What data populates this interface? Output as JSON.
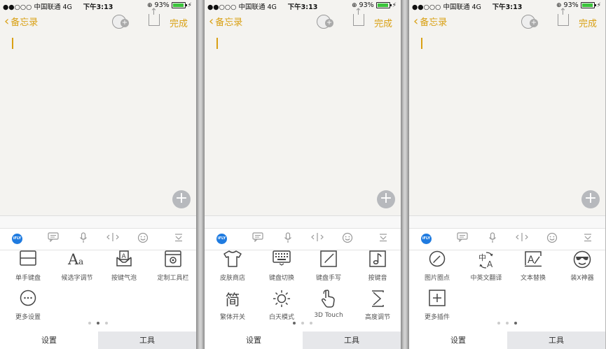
{
  "status": {
    "carrier": "●●○○○ 中国联通  4G",
    "time": "下午3:13",
    "battery": "93%",
    "battery_level": 0.93
  },
  "nav": {
    "back_label": "备忘录",
    "done_label": "完成"
  },
  "accent_color": "#d9a014",
  "keyboard": {
    "brand_badge": "iFLY",
    "toolbar_icons": [
      "ifly-logo-icon",
      "comment-icon",
      "microphone-icon",
      "cursor-move-icon",
      "emoji-icon",
      "hide-keyboard-icon"
    ],
    "tabs": {
      "settings": "设置",
      "tools": "工具"
    }
  },
  "screens": [
    {
      "page_index": 1,
      "items": [
        {
          "label": "单手键盘",
          "icon": "one-hand-keyboard-icon"
        },
        {
          "label": "候选字调节",
          "icon": "font-size-icon"
        },
        {
          "label": "按键气泡",
          "icon": "key-bubble-icon"
        },
        {
          "label": "定制工具栏",
          "icon": "custom-toolbar-icon"
        },
        {
          "label": "更多设置",
          "icon": "more-settings-icon"
        }
      ]
    },
    {
      "page_index": 0,
      "items": [
        {
          "label": "皮肤商店",
          "icon": "skin-store-icon"
        },
        {
          "label": "键盘切换",
          "icon": "keyboard-switch-icon"
        },
        {
          "label": "键盘手写",
          "icon": "handwriting-icon"
        },
        {
          "label": "按键音",
          "icon": "key-sound-icon"
        },
        {
          "label": "繁体开关",
          "icon": "traditional-chinese-icon",
          "glyph": "简"
        },
        {
          "label": "白天模式",
          "icon": "day-mode-icon"
        },
        {
          "label": "3D Touch",
          "icon": "3d-touch-icon"
        },
        {
          "label": "高度调节",
          "icon": "height-adjust-icon"
        }
      ]
    },
    {
      "page_index": 2,
      "items": [
        {
          "label": "图片圈点",
          "icon": "image-mark-icon"
        },
        {
          "label": "中英文翻译",
          "icon": "translate-icon",
          "glyph": "中 A"
        },
        {
          "label": "文本替换",
          "icon": "text-replace-icon"
        },
        {
          "label": "装X神器",
          "icon": "cool-face-icon"
        },
        {
          "label": "更多插件",
          "icon": "more-plugins-icon"
        }
      ]
    }
  ]
}
